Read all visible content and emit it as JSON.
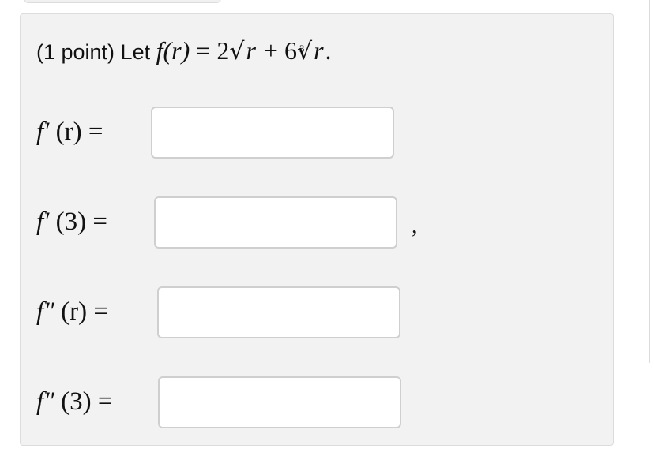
{
  "problem": {
    "intro": "(1 point) Let",
    "function_lhs": "f(r)",
    "equals": "=",
    "coef1": "2",
    "radicand1": "r",
    "plus": "+",
    "coef2": "6",
    "root_index": "3",
    "radicand2": "r",
    "period": "."
  },
  "questions": [
    {
      "fn": "f′",
      "arg": "(r)",
      "equals": "=",
      "value": "",
      "trailing": ""
    },
    {
      "fn": "f′",
      "arg": "(3)",
      "equals": "=",
      "value": "",
      "trailing": ","
    },
    {
      "fn": "f″",
      "arg": "(r)",
      "equals": "=",
      "value": "",
      "trailing": ""
    },
    {
      "fn": "f″",
      "arg": "(3)",
      "equals": "=",
      "value": "",
      "trailing": ""
    }
  ]
}
